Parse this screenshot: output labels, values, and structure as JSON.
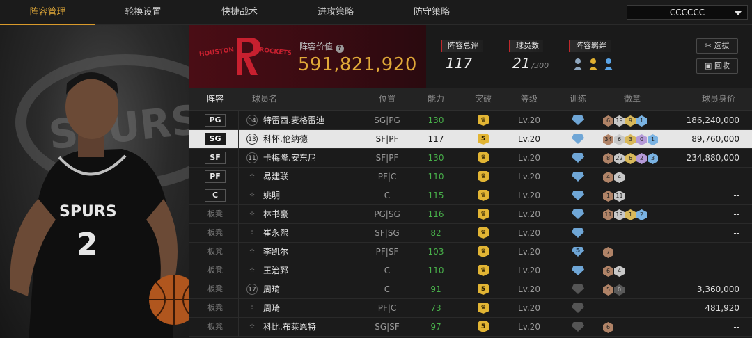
{
  "nav": {
    "tabs": [
      "阵容管理",
      "轮换设置",
      "快捷战术",
      "进攻策略",
      "防守策略"
    ],
    "active_tab": 0,
    "dropdown_value": "CCCCCC"
  },
  "header": {
    "team_name": "HOUSTON ROCKETS",
    "lineup_value_label": "阵容价值",
    "lineup_value": "591,821,920",
    "rating_label": "阵容总评",
    "rating_value": "117",
    "players_label": "球员数",
    "players_value": "21",
    "players_max": "/300",
    "chemistry_label": "阵容羁绊",
    "select_button": "选拔",
    "recycle_button": "回收"
  },
  "table": {
    "headers": [
      "阵容",
      "球员名",
      "位置",
      "能力",
      "突破",
      "等级",
      "训练",
      "徽章",
      "球员身价"
    ],
    "rows": [
      {
        "slot": "PG",
        "starter": true,
        "num": "04",
        "name": "特雷西.麦格雷迪",
        "pos": "SG|PG",
        "ability": "130",
        "green": true,
        "break": "",
        "level": "Lv.20",
        "train": "",
        "badges": [
          [
            "6",
            "bronze"
          ],
          [
            "19",
            "silver"
          ],
          [
            "9",
            "gold"
          ],
          [
            "1",
            "blue"
          ]
        ],
        "value": "186,240,000",
        "selected": false
      },
      {
        "slot": "SG",
        "starter": true,
        "num": "13",
        "name": "科怀.伦纳德",
        "pos": "SF|PF",
        "ability": "117",
        "green": false,
        "break": "5",
        "level": "Lv.20",
        "train": "",
        "badges": [
          [
            "34",
            "bronze"
          ],
          [
            "6",
            "silver"
          ],
          [
            "3",
            "gold"
          ],
          [
            "0",
            "purple"
          ],
          [
            "1",
            "blue"
          ]
        ],
        "value": "89,760,000",
        "selected": true
      },
      {
        "slot": "SF",
        "starter": true,
        "num": "11",
        "name": "卡梅隆.安东尼",
        "pos": "SF|PF",
        "ability": "130",
        "green": true,
        "break": "",
        "level": "Lv.20",
        "train": "",
        "badges": [
          [
            "8",
            "bronze"
          ],
          [
            "22",
            "silver"
          ],
          [
            "6",
            "gold"
          ],
          [
            "2",
            "purple"
          ],
          [
            "3",
            "blue"
          ]
        ],
        "value": "234,880,000",
        "selected": false
      },
      {
        "slot": "PF",
        "starter": true,
        "num": "",
        "name": "易建联",
        "pos": "PF|C",
        "ability": "110",
        "green": true,
        "break": "",
        "level": "Lv.20",
        "train": "",
        "badges": [
          [
            "4",
            "bronze"
          ],
          [
            "4",
            "silver"
          ]
        ],
        "value": "--",
        "selected": false
      },
      {
        "slot": "C",
        "starter": true,
        "num": "",
        "name": "姚明",
        "pos": "C",
        "ability": "115",
        "green": true,
        "break": "",
        "level": "Lv.20",
        "train": "",
        "badges": [
          [
            "1",
            "bronze"
          ],
          [
            "11",
            "silver"
          ]
        ],
        "value": "--",
        "selected": false
      },
      {
        "slot": "板凳",
        "starter": false,
        "num": "",
        "name": "林书豪",
        "pos": "PG|SG",
        "ability": "116",
        "green": true,
        "break": "",
        "level": "Lv.20",
        "train": "",
        "badges": [
          [
            "11",
            "bronze"
          ],
          [
            "19",
            "silver"
          ],
          [
            "1",
            "gold"
          ],
          [
            "2",
            "blue"
          ]
        ],
        "value": "--",
        "selected": false
      },
      {
        "slot": "板凳",
        "starter": false,
        "num": "",
        "name": "崔永熙",
        "pos": "SF|SG",
        "ability": "82",
        "green": true,
        "break": "",
        "level": "Lv.20",
        "train": "",
        "badges": [],
        "value": "--",
        "selected": false
      },
      {
        "slot": "板凳",
        "starter": false,
        "num": "",
        "name": "李凯尔",
        "pos": "PF|SF",
        "ability": "103",
        "green": true,
        "break": "",
        "level": "Lv.20",
        "train": "5",
        "badges": [
          [
            "7",
            "bronze"
          ]
        ],
        "value": "--",
        "selected": false
      },
      {
        "slot": "板凳",
        "starter": false,
        "num": "",
        "name": "王治郅",
        "pos": "C",
        "ability": "110",
        "green": true,
        "break": "",
        "level": "Lv.20",
        "train": "",
        "badges": [
          [
            "6",
            "bronze"
          ],
          [
            "4",
            "silver"
          ]
        ],
        "value": "--",
        "selected": false
      },
      {
        "slot": "板凳",
        "starter": false,
        "num": "17",
        "name": "周琦",
        "pos": "C",
        "ability": "91",
        "green": true,
        "break": "5",
        "level": "Lv.20",
        "train": "grey",
        "badges": [
          [
            "5",
            "bronze"
          ],
          [
            "0",
            "dark"
          ]
        ],
        "value": "3,360,000",
        "selected": false
      },
      {
        "slot": "板凳",
        "starter": false,
        "num": "",
        "name": "周琦",
        "pos": "PF|C",
        "ability": "73",
        "green": true,
        "break": "",
        "level": "Lv.20",
        "train": "grey",
        "badges": [],
        "value": "481,920",
        "selected": false
      },
      {
        "slot": "板凳",
        "starter": false,
        "num": "",
        "name": "科比.布莱恩特",
        "pos": "SG|SF",
        "ability": "97",
        "green": true,
        "break": "5",
        "level": "Lv.20",
        "train": "grey",
        "badges": [
          [
            "6",
            "bronze"
          ]
        ],
        "value": "--",
        "selected": false
      }
    ]
  },
  "player_card": {
    "jersey_team": "SPURS",
    "jersey_number": "2"
  },
  "colors": {
    "accent": "#e0a838",
    "selected_row": "#e6e6e6",
    "team_red": "#4a0d15"
  }
}
